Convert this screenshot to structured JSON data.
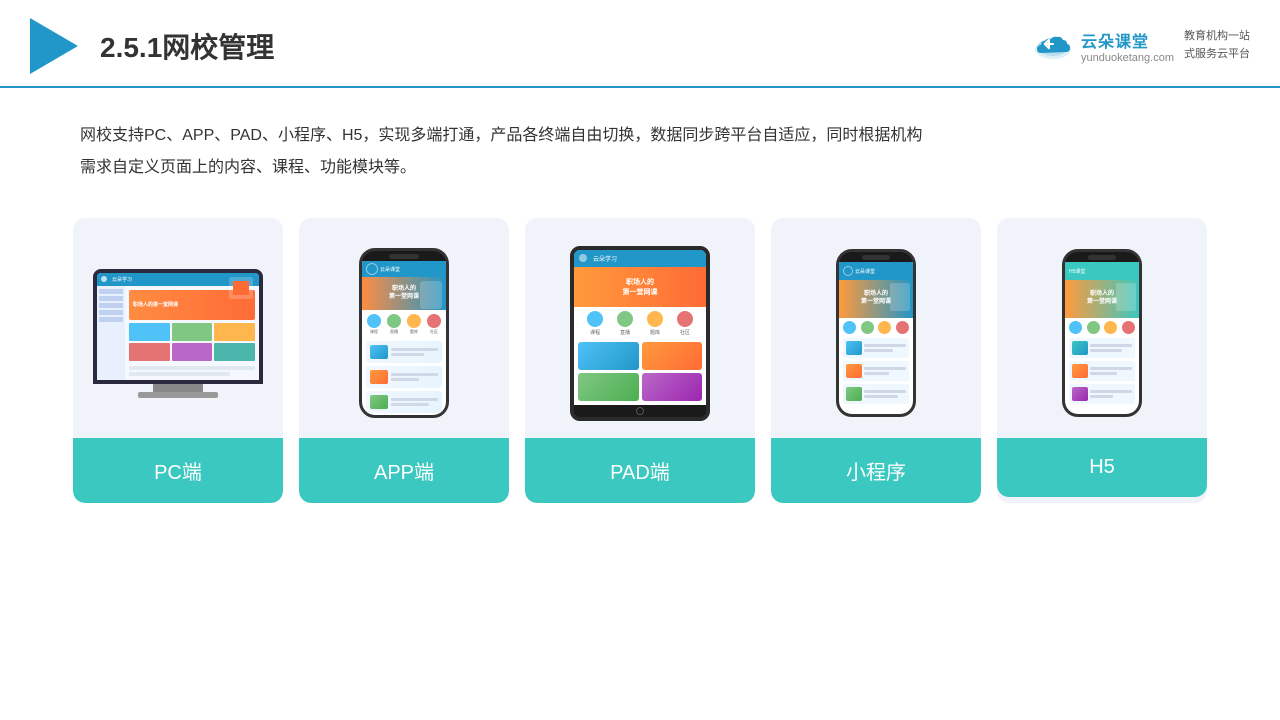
{
  "header": {
    "title": "2.5.1网校管理",
    "brand_name": "云朵课堂",
    "brand_url": "yunduoketang.com",
    "brand_tagline": "教育机构一站\n式服务云平台"
  },
  "description": "网校支持PC、APP、PAD、小程序、H5，实现多端打通，产品各终端自由切换，数据同步跨平台自适应，同时根据机构\n需求自定义页面上的内容、课程、功能模块等。",
  "cards": [
    {
      "id": "pc",
      "label": "PC端"
    },
    {
      "id": "app",
      "label": "APP端"
    },
    {
      "id": "pad",
      "label": "PAD端"
    },
    {
      "id": "miniapp",
      "label": "小程序"
    },
    {
      "id": "h5",
      "label": "H5"
    }
  ],
  "colors": {
    "teal": "#3bc8c0",
    "blue": "#2196c8",
    "accent": "#ff8c42"
  }
}
